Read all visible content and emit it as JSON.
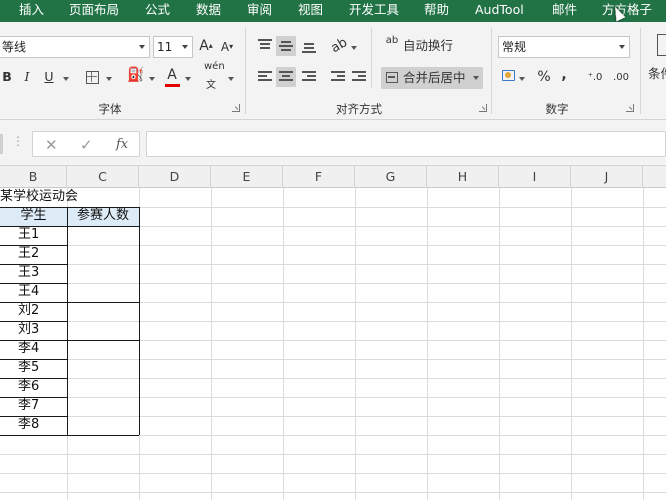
{
  "ribbon_tabs": [
    "插入",
    "页面布局",
    "公式",
    "数据",
    "审阅",
    "视图",
    "开发工具",
    "帮助",
    "AudTool",
    "邮件",
    "方方格子"
  ],
  "font": {
    "name": "等线",
    "size": "11",
    "grow_label": "A",
    "shrink_label": "A",
    "bold_label": "B",
    "italic_label": "I",
    "underline_label": "U",
    "font_color_label": "A",
    "phonetic_label": "wén"
  },
  "alignment": {
    "wrap_label": "自动换行",
    "wrap_icon_label": "ab",
    "merge_label": "合并后居中"
  },
  "number": {
    "format": "常规",
    "percent_label": "%",
    "comma_label": ",",
    "inc_decimal_label": "⁺.0",
    "dec_decimal_label": ".00"
  },
  "styles": {
    "cond_format_label": "条件"
  },
  "group_labels": {
    "font": "字体",
    "alignment": "对齐方式",
    "number": "数字"
  },
  "formula_bar": {
    "cancel": "✕",
    "enter": "✓",
    "fx": "fx",
    "value": ""
  },
  "columns": [
    "B",
    "C",
    "D",
    "E",
    "F",
    "G",
    "H",
    "I",
    "J"
  ],
  "sheet": {
    "title": "某学校运动会",
    "headers": [
      "学生",
      "参赛人数"
    ],
    "students": [
      "王1",
      "王2",
      "王3",
      "王4",
      "刘2",
      "刘3",
      "李4",
      "李5",
      "李6",
      "李7",
      "李8"
    ]
  },
  "colors": {
    "ribbon": "#217346",
    "header_fill": "#ddebf7",
    "pressed": "#d0d0d0",
    "font_color_bar": "#e00000"
  }
}
